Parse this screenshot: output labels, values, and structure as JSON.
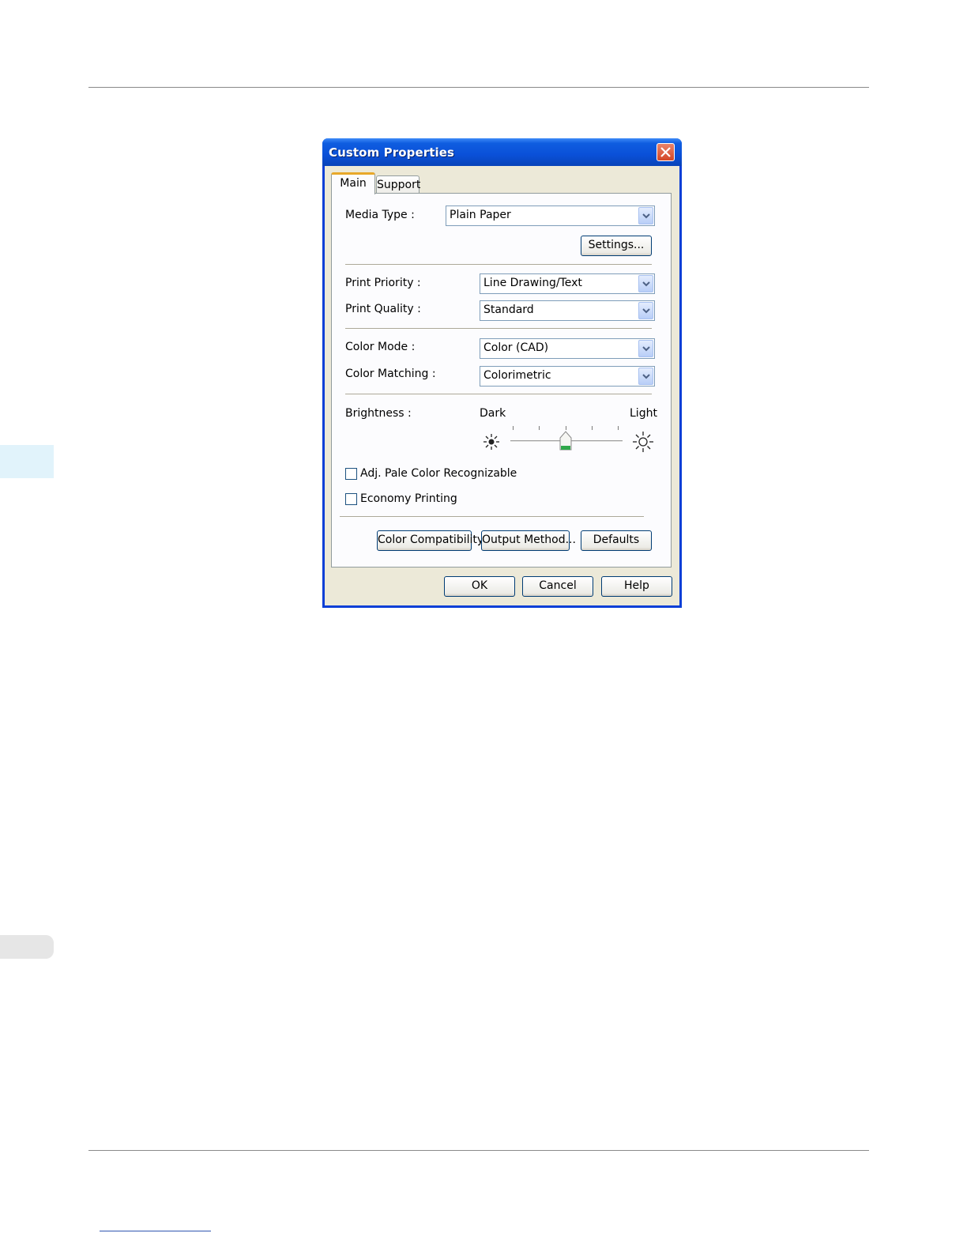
{
  "dialog": {
    "title": "Custom Properties",
    "tabs": [
      "Main",
      "Support"
    ],
    "media_type": {
      "label": "Media Type :",
      "value": "Plain Paper"
    },
    "settings_button": "Settings...",
    "print_priority": {
      "label": "Print Priority :",
      "value": "Line Drawing/Text"
    },
    "print_quality": {
      "label": "Print Quality :",
      "value": "Standard"
    },
    "color_mode": {
      "label": "Color Mode :",
      "value": "Color (CAD)"
    },
    "color_matching": {
      "label": "Color Matching :",
      "value": "Colorimetric"
    },
    "brightness": {
      "label": "Brightness :",
      "dark_label": "Dark",
      "light_label": "Light",
      "level_fraction": 0.5
    },
    "checkboxes": [
      {
        "label": "Adj. Pale Color Recognizable",
        "checked": false
      },
      {
        "label": "Economy Printing",
        "checked": false
      }
    ],
    "buttons": {
      "color_compatibility": "Color Compatibility",
      "output_method": "Output Method...",
      "defaults": "Defaults",
      "ok": "OK",
      "cancel": "Cancel",
      "help": "Help"
    }
  },
  "colors": {
    "titlebar": "#0a50d8",
    "dialog_bg": "#ece9d8",
    "tab_highlight": "#e8a82a",
    "chapter_tab": "#e1f3fb",
    "slider_thumb_accent": "#2fa84a"
  }
}
